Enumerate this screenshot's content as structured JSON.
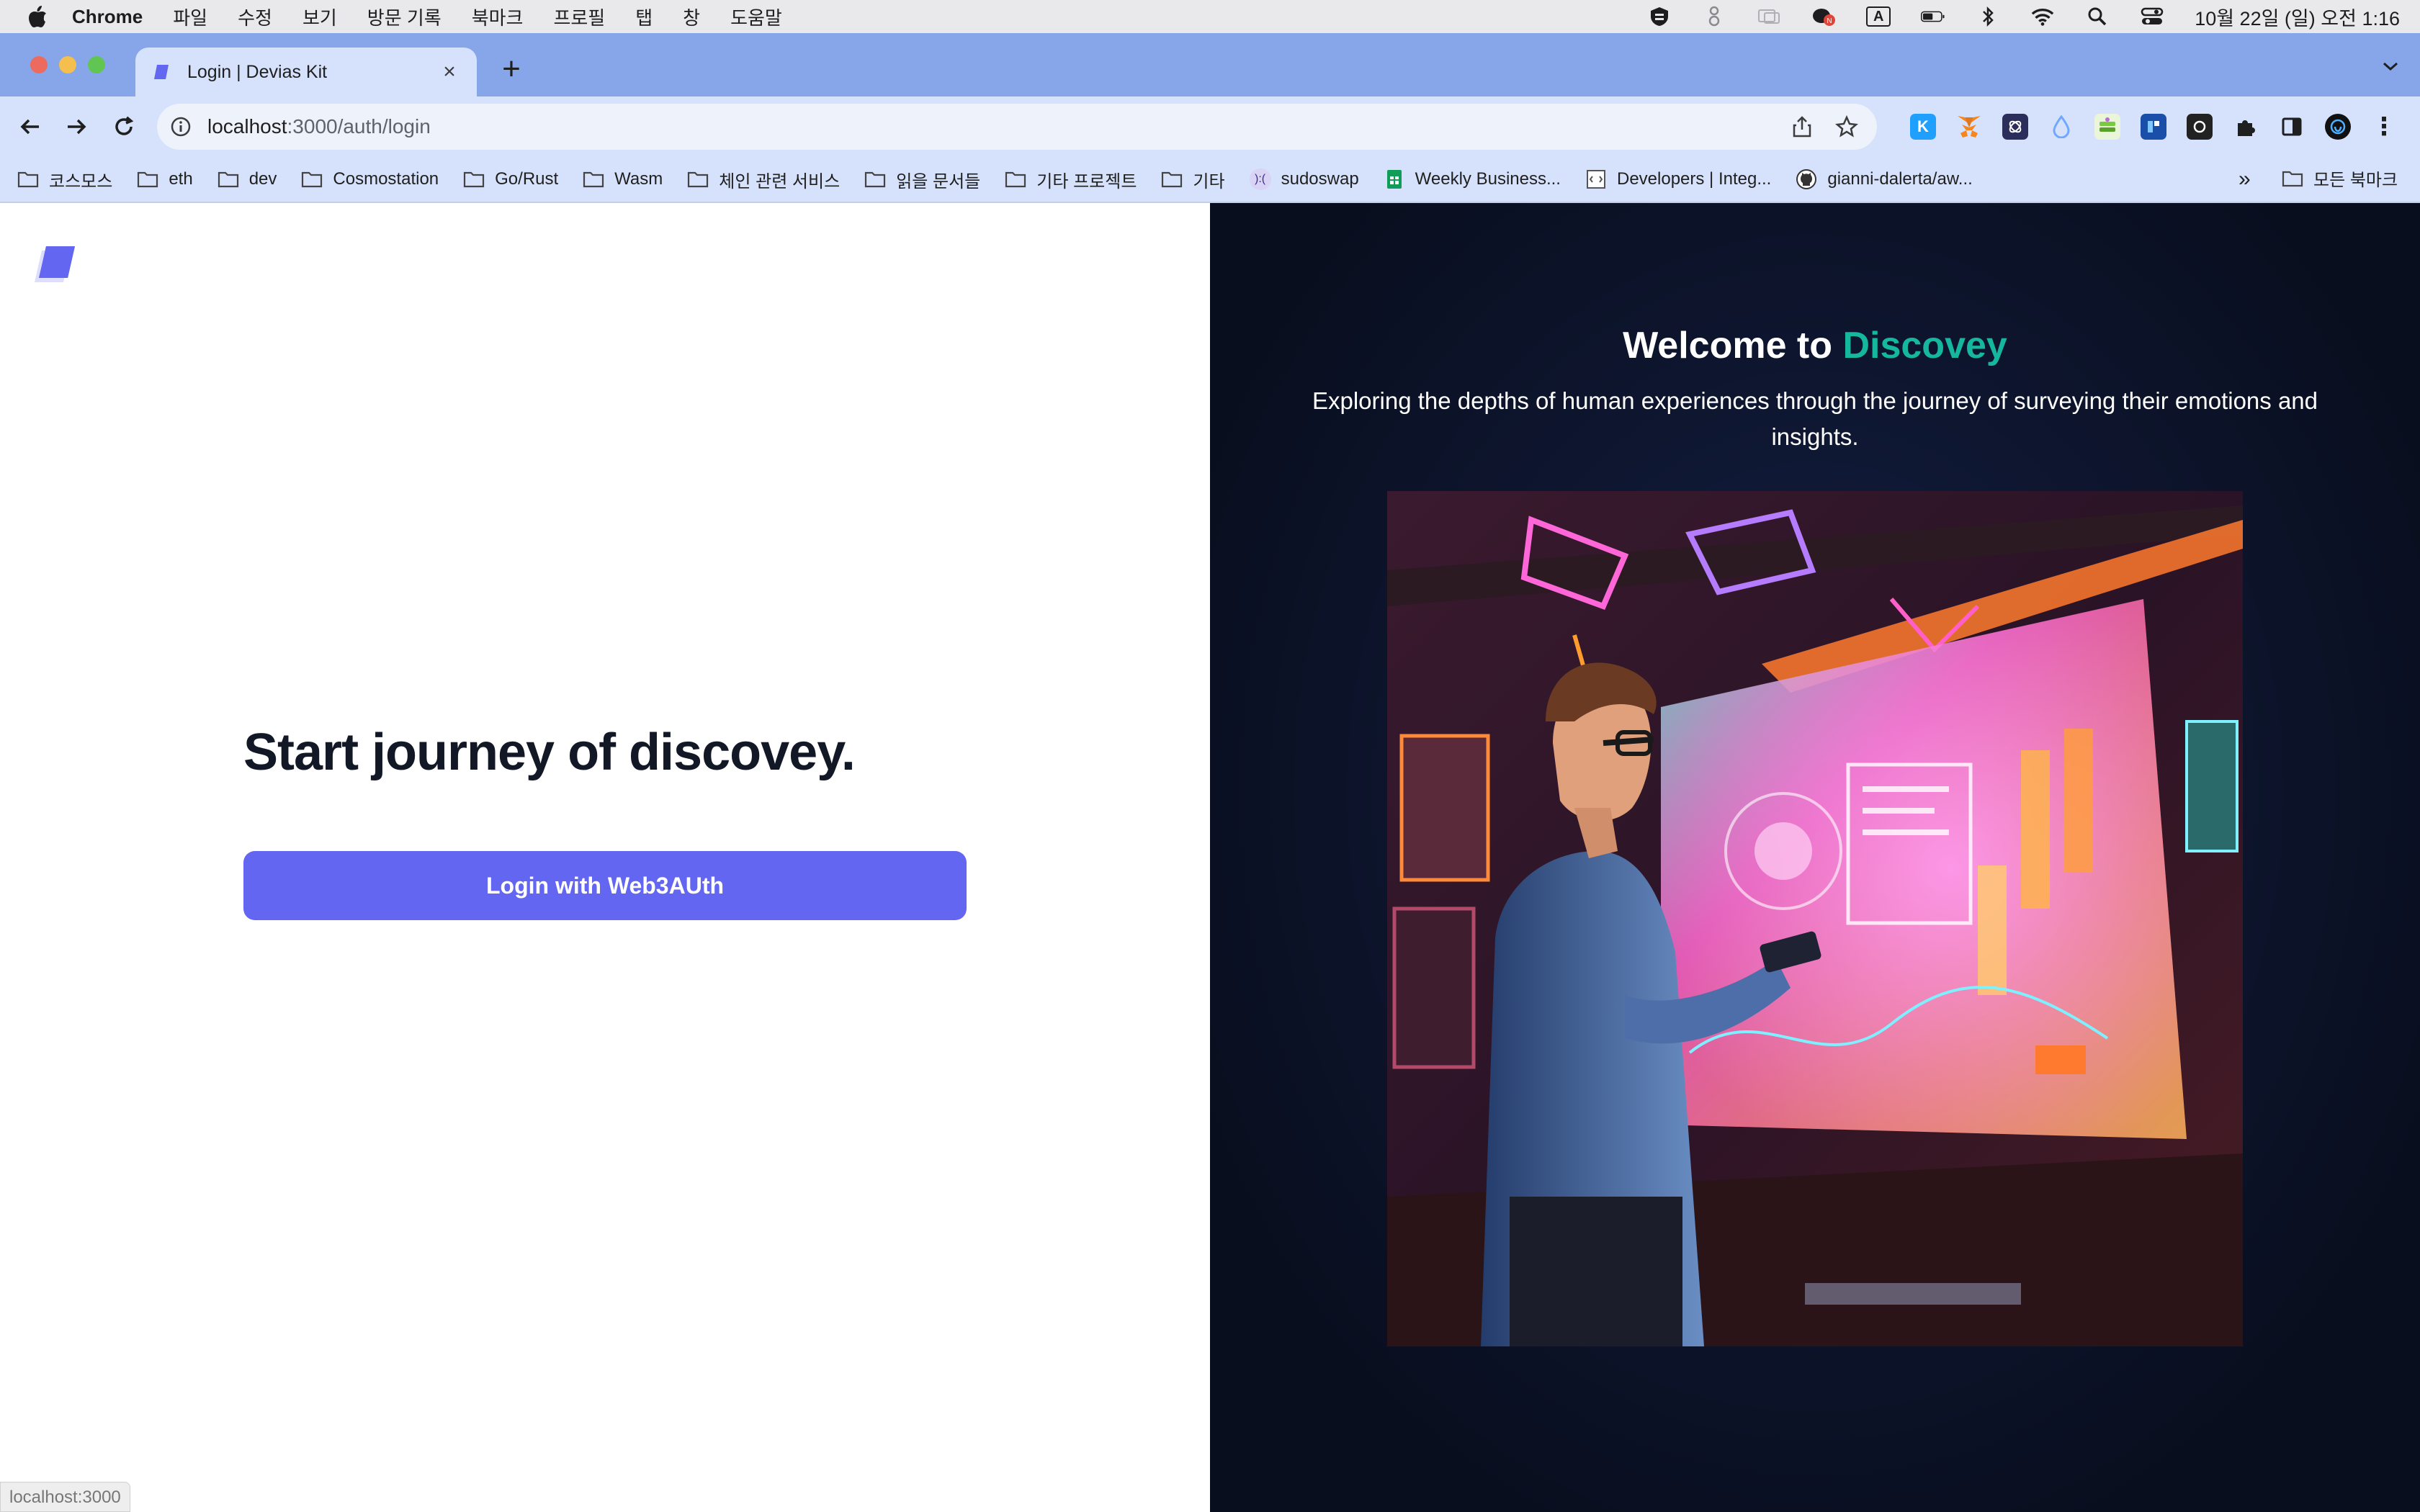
{
  "menubar": {
    "app_name": "Chrome",
    "items": [
      "파일",
      "수정",
      "보기",
      "방문 기록",
      "북마크",
      "프로필",
      "탭",
      "창",
      "도움말"
    ],
    "clock": "10월 22일 (일) 오전 1:16",
    "status_icons": [
      "vpn-shield-icon",
      "accessibility-icon",
      "display-icon",
      "messenger-icon",
      "input-source-icon",
      "battery-icon",
      "bluetooth-icon",
      "wifi-icon",
      "spotlight-icon",
      "control-center-icon"
    ],
    "input_source_label": "A",
    "notification_badge": "N"
  },
  "browser": {
    "tab": {
      "title": "Login | Devias Kit"
    },
    "new_tab_glyph": "+",
    "close_glyph": "×",
    "address": {
      "host": "localhost",
      "path": ":3000/auth/login"
    },
    "extensions": [
      {
        "icon": "k-extension-icon",
        "label": "K",
        "color": "#1fa0ff"
      },
      {
        "icon": "metamask-icon",
        "label": "",
        "color": "#f6851b"
      },
      {
        "icon": "cosmos-wallet-icon",
        "label": "",
        "color": "#2b2d5b"
      },
      {
        "icon": "water-drop-icon",
        "label": "",
        "color": "#6fa8ff"
      },
      {
        "icon": "android-stack-icon",
        "label": "",
        "color": "#7ac943"
      },
      {
        "icon": "blue-square-extension-icon",
        "label": "",
        "color": "#1b4ea8"
      },
      {
        "icon": "dark-square-extension-icon",
        "label": "",
        "color": "#222222"
      },
      {
        "icon": "puzzle-extensions-icon",
        "label": "",
        "color": "#1f1f1f"
      },
      {
        "icon": "side-panel-icon",
        "label": "",
        "color": "#1f1f1f"
      },
      {
        "icon": "profile-avatar-icon",
        "label": "",
        "color": "#111111"
      },
      {
        "icon": "kebab-menu-icon",
        "label": "⋮",
        "color": "#1f1f1f"
      }
    ],
    "bookmarks": [
      {
        "type": "folder",
        "label": "코스모스"
      },
      {
        "type": "folder",
        "label": "eth"
      },
      {
        "type": "folder",
        "label": "dev"
      },
      {
        "type": "folder",
        "label": "Cosmostation"
      },
      {
        "type": "folder",
        "label": "Go/Rust"
      },
      {
        "type": "folder",
        "label": "Wasm"
      },
      {
        "type": "folder",
        "label": "체인 관련 서비스"
      },
      {
        "type": "folder",
        "label": "읽을 문서들"
      },
      {
        "type": "folder",
        "label": "기타 프로젝트"
      },
      {
        "type": "folder",
        "label": "기타"
      },
      {
        "type": "site",
        "label": "sudoswap",
        "favicon": "sudoswap-icon",
        "favicon_text": "):(",
        "color": "#d9d3f5"
      },
      {
        "type": "site",
        "label": "Weekly Business...",
        "favicon": "google-sheets-icon",
        "favicon_text": "",
        "color": "#0f9d58"
      },
      {
        "type": "site",
        "label": "Developers | Integ...",
        "favicon": "developers-icon",
        "favicon_text": "",
        "color": "#ffffff"
      },
      {
        "type": "site",
        "label": "gianni-dalerta/aw...",
        "favicon": "github-icon",
        "favicon_text": "",
        "color": "#ffffff"
      }
    ],
    "bookmarks_overflow": "»",
    "all_bookmarks": "모든 북마크"
  },
  "page": {
    "headline": "Start journey of discovey.",
    "login_button": "Login with Web3AUth",
    "welcome_prefix": "Welcome to ",
    "brand": "Discovey",
    "subtitle": "Exploring the depths of human experiences through the journey of surveying their emotions and insights.",
    "hero_image": "illustration-of-man-with-glasses-holding-phone-in-front-of-neon-holographic-data-screens",
    "accent_color": "#6366f1",
    "brand_color": "#15b79e",
    "dark_bg": "#0b1226"
  },
  "status_bar": {
    "url": "localhost:3000"
  }
}
